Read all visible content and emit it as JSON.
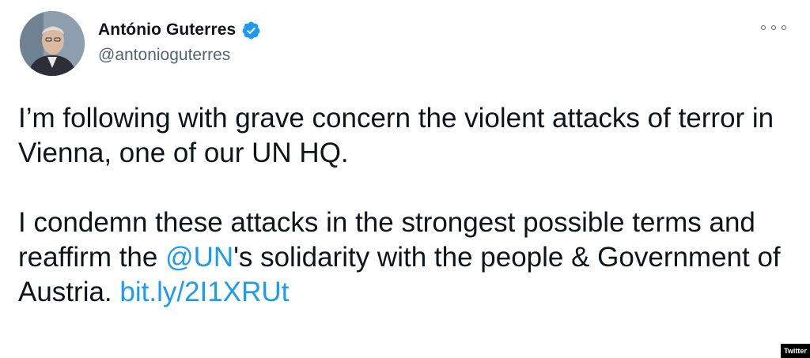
{
  "author": {
    "display_name": "António Guterres",
    "handle": "@antonioguterres",
    "verified": true
  },
  "icons": {
    "verified": "verified-badge-icon",
    "more": "more-options-icon"
  },
  "tweet": {
    "paragraph_1": "I’m following with grave concern the violent attacks of terror in Vienna, one of our UN HQ.",
    "p2_text_1": "I condemn these attacks in the strongest possible terms and reaffirm the ",
    "p2_mention": "@UN",
    "p2_text_2": "'s solidarity with the people & Government of Austria. ",
    "p2_link": "bit.ly/2I1XRUt"
  },
  "source_badge": "Twitter",
  "colors": {
    "link": "#1d9bf0",
    "verified": "#1d9bf0",
    "text": "#0f1419",
    "secondary": "#536471"
  }
}
